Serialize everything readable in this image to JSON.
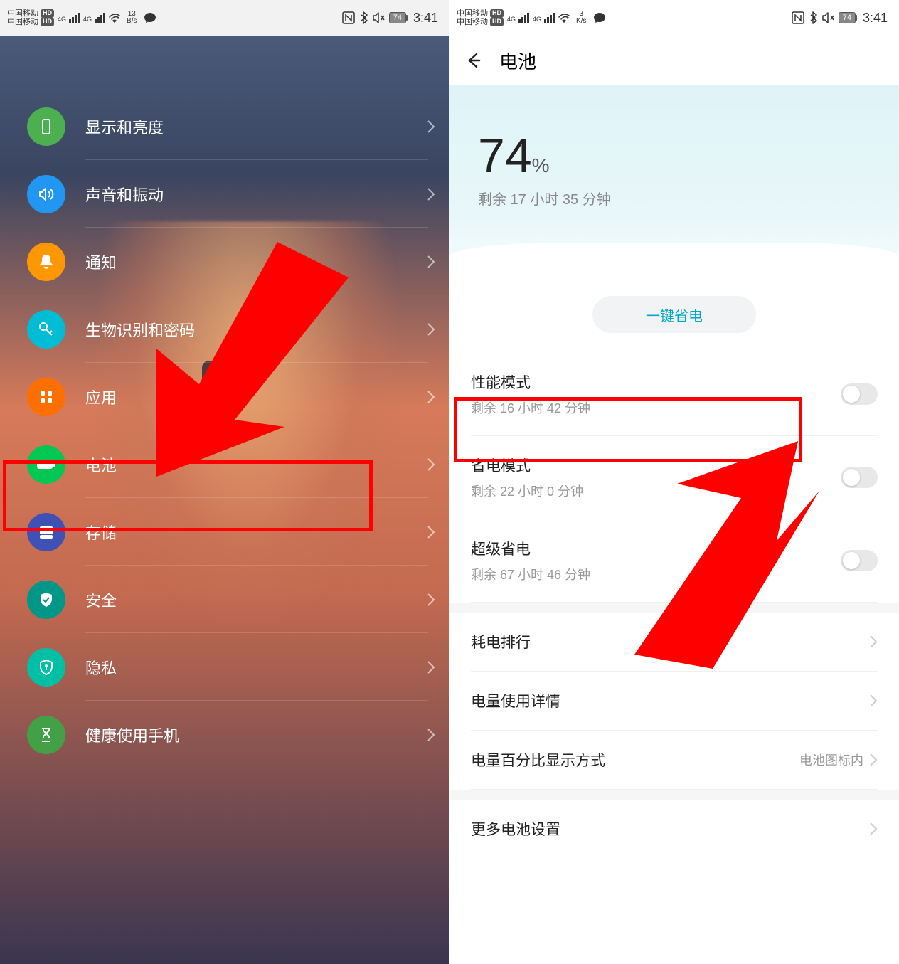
{
  "status": {
    "carrier": "中国移动",
    "hd": "HD",
    "net": "4G",
    "speed_left_num": "13",
    "speed_left_unit": "B/s",
    "speed_right_num": "3",
    "speed_right_unit": "K/s",
    "battery_pct": "74",
    "time": "3:41"
  },
  "settings_items": [
    {
      "label": "显示和亮度",
      "color": "c-green"
    },
    {
      "label": "声音和振动",
      "color": "c-blue"
    },
    {
      "label": "通知",
      "color": "c-orange"
    },
    {
      "label": "生物识别和密码",
      "color": "c-cyan"
    },
    {
      "label": "应用",
      "color": "c-orange2"
    },
    {
      "label": "电池",
      "color": "c-green2"
    },
    {
      "label": "存储",
      "color": "c-blue2"
    },
    {
      "label": "安全",
      "color": "c-teal"
    },
    {
      "label": "隐私",
      "color": "c-teal2"
    },
    {
      "label": "健康使用手机",
      "color": "c-green3"
    }
  ],
  "battery_page": {
    "title": "电池",
    "pct": "74",
    "pct_sym": "%",
    "remain": "剩余 17 小时 35 分钟",
    "onekey": "一键省电",
    "modes": [
      {
        "title": "性能模式",
        "sub": "剩余 16 小时 42 分钟"
      },
      {
        "title": "省电模式",
        "sub": "剩余 22 小时 0 分钟"
      },
      {
        "title": "超级省电",
        "sub": "剩余 67 小时 46 分钟"
      }
    ],
    "rows": [
      {
        "title": "耗电排行"
      },
      {
        "title": "电量使用详情"
      },
      {
        "title": "电量百分比显示方式",
        "value": "电池图标内"
      }
    ],
    "more": "更多电池设置"
  }
}
